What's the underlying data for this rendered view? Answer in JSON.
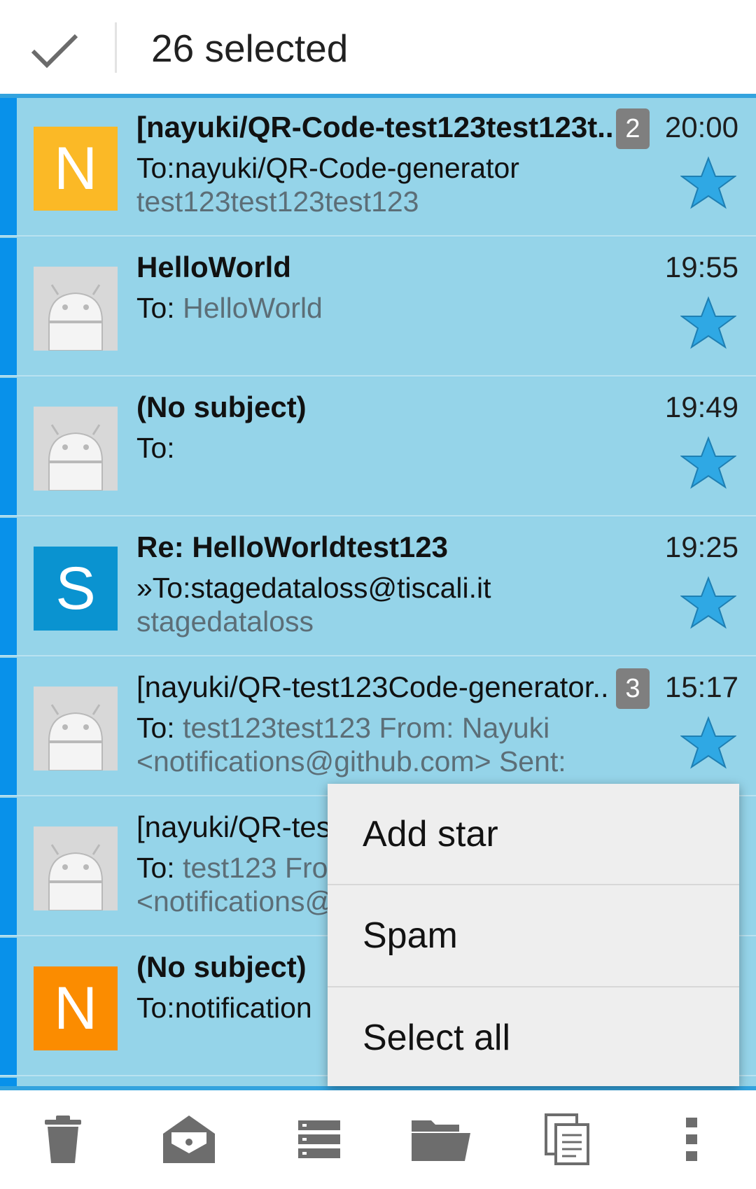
{
  "action_bar": {
    "title": "26 selected",
    "done_icon": "checkmark-icon"
  },
  "messages": [
    {
      "avatar_letter": "N",
      "avatar_color": "#fbb926",
      "subject": "[nayuki/QR-Code-test123test123t..",
      "subject_bold": true,
      "to_prefix": "To:nayuki/QR-Code-generator",
      "to_value": "",
      "preview": "test123test123test123",
      "thread_count": "2",
      "time": "20:00",
      "starred": true
    },
    {
      "avatar_letter": "",
      "avatar_color": "#d8d8d8",
      "subject": "HelloWorld",
      "subject_bold": true,
      "to_prefix": "To: ",
      "to_value": "HelloWorld",
      "preview": "",
      "thread_count": "",
      "time": "19:55",
      "starred": true
    },
    {
      "avatar_letter": "",
      "avatar_color": "#d8d8d8",
      "subject": "(No subject)",
      "subject_bold": true,
      "to_prefix": "To:",
      "to_value": "",
      "preview": "",
      "thread_count": "",
      "time": "19:49",
      "starred": true
    },
    {
      "avatar_letter": "S",
      "avatar_color": "#0a93d0",
      "subject": "Re: HelloWorldtest123",
      "subject_bold": true,
      "to_prefix": "»To:stagedataloss@tiscali.it",
      "to_value": "",
      "preview": "stagedataloss",
      "thread_count": "",
      "time": "19:25",
      "starred": true
    },
    {
      "avatar_letter": "",
      "avatar_color": "#d8d8d8",
      "subject": "[nayuki/QR-test123Code-generator..",
      "subject_bold": false,
      "to_prefix": "To: ",
      "to_value": "test123test123 From: Nayuki",
      "preview": "<notifications@github.com> Sent:",
      "thread_count": "3",
      "time": "15:17",
      "starred": true
    },
    {
      "avatar_letter": "",
      "avatar_color": "#d8d8d8",
      "subject": "[nayuki/QR-tes",
      "subject_bold": false,
      "to_prefix": "To: ",
      "to_value": "test123 Fro",
      "preview": "<notifications@",
      "thread_count": "",
      "time": "",
      "starred": false
    },
    {
      "avatar_letter": "N",
      "avatar_color": "#fb8c00",
      "subject": "(No subject)",
      "subject_bold": true,
      "to_prefix": "To:notification",
      "to_value": "",
      "preview": "",
      "thread_count": "",
      "time": "",
      "starred": false
    }
  ],
  "menu": {
    "items": [
      "Add star",
      "Spam",
      "Select all"
    ]
  },
  "toolbar": {
    "icons": [
      "trash-icon",
      "mark-read-icon",
      "list-icon",
      "folder-icon",
      "copy-icon",
      "more-vert-icon"
    ]
  },
  "colors": {
    "selection_bar": "#0891ea",
    "row_selected": "#95d4e9",
    "accent": "#33a3de",
    "star": "#2fa8e4"
  }
}
